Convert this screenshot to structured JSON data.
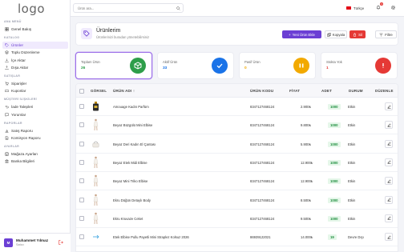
{
  "app": {
    "logo_text": "logo"
  },
  "sidebar": {
    "sections": [
      {
        "title": "ANA MENÜ",
        "items": [
          {
            "label": "Genel Bakış",
            "icon": "grid-icon"
          }
        ]
      },
      {
        "title": "KATALOG",
        "items": [
          {
            "label": "Ürünler",
            "icon": "tag-icon",
            "active": true
          },
          {
            "label": "Toplu Düzenleme",
            "icon": "layers-icon"
          },
          {
            "label": "İçe Aktar",
            "icon": "download-icon"
          },
          {
            "label": "Dışa Aktar",
            "icon": "upload-icon"
          }
        ]
      },
      {
        "title": "SATIŞLAR",
        "items": [
          {
            "label": "Siparişler",
            "icon": "cart-icon"
          },
          {
            "label": "Kuponlar",
            "icon": "ticket-icon"
          }
        ]
      },
      {
        "title": "MÜŞTERİ İLİŞKİLERİ",
        "items": [
          {
            "label": "İade Talepleri",
            "icon": "return-icon"
          },
          {
            "label": "Yorumlar",
            "icon": "comment-icon"
          }
        ]
      },
      {
        "title": "RAPORLAR",
        "items": [
          {
            "label": "Satış Raporu",
            "icon": "chart-icon"
          },
          {
            "label": "Komisyon Raporu",
            "icon": "document-icon"
          }
        ]
      },
      {
        "title": "AYARLAR",
        "items": [
          {
            "label": "Mağaza Ayarları",
            "icon": "store-icon"
          },
          {
            "label": "Banka Bilgileri",
            "icon": "bank-icon"
          }
        ]
      }
    ],
    "user": {
      "initials": "M",
      "name": "Muhammet Yılmaz",
      "role": "Satıcı"
    }
  },
  "topbar": {
    "search_placeholder": "Ürün ara...",
    "language": "Türkçe",
    "notification_count": "3"
  },
  "header": {
    "title": "Ürünlerim",
    "subtitle": "Ürünlerinizi buradan yönetebilirsiniz",
    "buttons": {
      "new": "Yeni Ürün Ekle",
      "copy": "Kopyala",
      "delete": "Sil",
      "filter": "Filtre"
    }
  },
  "stats": [
    {
      "label": "Toplam Ürün",
      "value": "26",
      "color": "#2e9e4a",
      "icon": "cube-icon"
    },
    {
      "label": "Aktif Ürün",
      "value": "33",
      "color": "#1a73e8",
      "icon": "check-icon"
    },
    {
      "label": "Pasif Ürün",
      "value": "0",
      "color": "#f2a900",
      "icon": "pause-icon"
    },
    {
      "label": "Stokta Yok",
      "value": "1",
      "color": "#e53935",
      "icon": "alert-icon"
    }
  ],
  "table": {
    "columns": {
      "image": "GÖRSEL",
      "name": "ÜRÜN ADI",
      "code": "ÜRÜN KODU",
      "price": "FİYAT",
      "stock": "ADET",
      "status": "DURUM",
      "edit": "DÜZENLE"
    },
    "rows": [
      {
        "name": "Amouage Kadın Parfüm",
        "code": "8347127468124",
        "price": "2.900₺",
        "stock": "1000",
        "status": "Etkin",
        "thumb": "bottle"
      },
      {
        "name": "Beyaz Büzgülü Mini Elbise",
        "code": "8347127468124",
        "price": "9.800₺",
        "stock": "1000",
        "status": "Etkin",
        "thumb": "dress"
      },
      {
        "name": "Beyaz Deri Kadın El Çantası",
        "code": "8347127468124",
        "price": "5.900₺",
        "stock": "1000",
        "status": "Etkin",
        "thumb": "bag"
      },
      {
        "name": "Beyaz Etek Midi Elbise",
        "code": "8347127468124",
        "price": "12.900₺",
        "stock": "1000",
        "status": "Etkin",
        "thumb": "dress"
      },
      {
        "name": "Beyaz Mini Triko Elbise",
        "code": "8347127468124",
        "price": "12.900₺",
        "stock": "1000",
        "status": "Etkin",
        "thumb": "dress"
      },
      {
        "name": "Ekru Düğün Detaylı Body",
        "code": "8347127468124",
        "price": "8.500₺",
        "stock": "1000",
        "status": "Etkin",
        "thumb": "dress"
      },
      {
        "name": "Ekru Kruvaze Ceket",
        "code": "8347127468124",
        "price": "9.500₺",
        "stock": "1000",
        "status": "Etkin",
        "thumb": "dress"
      },
      {
        "name": "Etek Elbise Pullu Payetli Mini Straplez Kolsuz 2026",
        "code": "86939122021",
        "price": "14.000₺",
        "stock": "19",
        "status": "Devre Dışı",
        "thumb": "blank"
      }
    ]
  },
  "colors": {
    "accent": "#6b3fd4",
    "danger": "#e53935",
    "success": "#1e8e3e"
  }
}
